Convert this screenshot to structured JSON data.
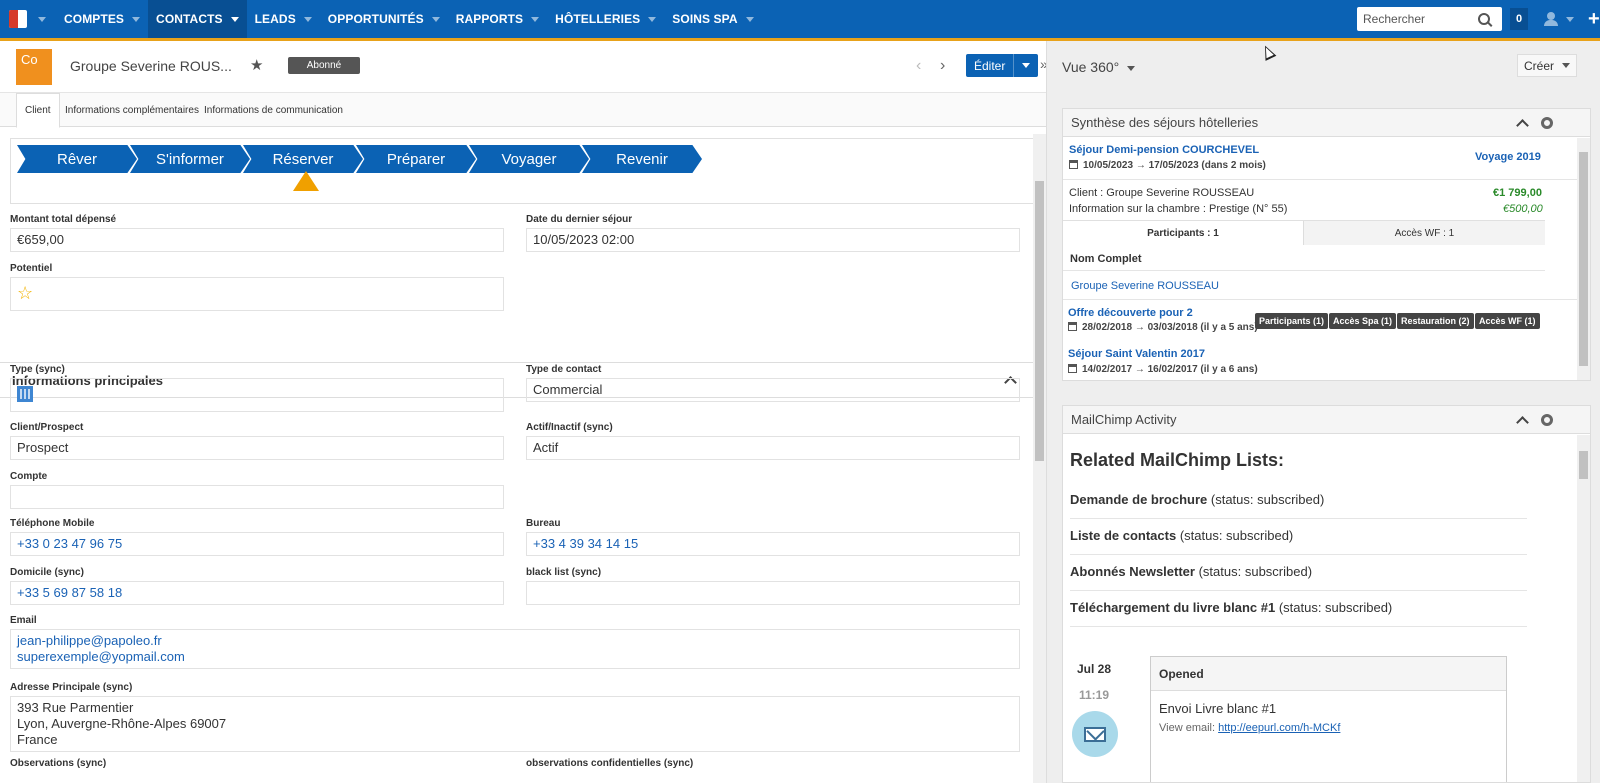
{
  "nav": {
    "items": [
      {
        "label": "COMPTES"
      },
      {
        "label": "CONTACTS"
      },
      {
        "label": "LEADS"
      },
      {
        "label": "OPPORTUNITÉS"
      },
      {
        "label": "RAPPORTS"
      },
      {
        "label": "HÔTELLERIES"
      },
      {
        "label": "SOINS SPA"
      }
    ],
    "active": "CONTACTS",
    "search_placeholder": "Rechercher",
    "notifications": "0",
    "plus": "+"
  },
  "record": {
    "avatar": "Co",
    "title": "Groupe Severine ROUS...",
    "status": "Abonné",
    "edit_label": "Éditer",
    "prev": "‹",
    "next": "›",
    "more": "»",
    "favorite": "★"
  },
  "tabs": [
    "Client",
    "Informations complémentaires",
    "Informations de communication"
  ],
  "stages": [
    "Rêver",
    "S'informer",
    "Réserver",
    "Préparer",
    "Voyager",
    "Revenir"
  ],
  "current_stage": "Réserver",
  "fields": {
    "montant": {
      "label": "Montant total dépensé",
      "value": "€659,00"
    },
    "dernier_sejour": {
      "label": "Date du dernier séjour",
      "value": "10/05/2023 02:00"
    },
    "potentiel": {
      "label": "Potentiel",
      "value": "☆"
    },
    "type": {
      "label": "Type (sync)",
      "icon": "building-icon"
    },
    "type_contact": {
      "label": "Type de contact",
      "value": "Commercial"
    },
    "client_prospect": {
      "label": "Client/Prospect",
      "value": "Prospect"
    },
    "actif": {
      "label": "Actif/Inactif (sync)",
      "value": "Actif"
    },
    "compte": {
      "label": "Compte",
      "value": ""
    },
    "tel_mobile": {
      "label": "Téléphone Mobile",
      "value": "+33 0 23 47 96 75"
    },
    "bureau": {
      "label": "Bureau",
      "value": "+33 4 39 34 14 15"
    },
    "domicile": {
      "label": "Domicile (sync)",
      "value": "+33 5 69 87 58 18"
    },
    "blacklist": {
      "label": "black list (sync)",
      "value": ""
    },
    "email": {
      "label": "Email",
      "values": [
        "jean-philippe@papoleo.fr",
        "superexemple@yopmail.com"
      ]
    },
    "adresse": {
      "label": "Adresse Principale (sync)",
      "lines": [
        "393 Rue Parmentier",
        "Lyon, Auvergne-Rhône-Alpes 69007",
        "France"
      ]
    },
    "observations": {
      "label": "Observations (sync)"
    },
    "observations_conf": {
      "label": "observations confidentielles (sync)"
    }
  },
  "section": {
    "title": "Informations principales"
  },
  "right": {
    "vue_title": "Vue 360°",
    "creer_label": "Créer",
    "sejours": {
      "title": "Synthèse des séjours hôtelleries",
      "s1": {
        "name": "Séjour Demi-pension COURCHEVEL",
        "dates": "10/05/2023 → 17/05/2023 (dans 2 mois)",
        "tag": "Voyage 2019",
        "client": "Client : Groupe Severine ROUSSEAU",
        "price": "€1 799,00",
        "chambre": "Information sur la chambre : Prestige (N° 55)",
        "price2": "€500,00",
        "tab_participants": "Participants : 1",
        "tab_acces": "Accès WF : 1",
        "col_nom": "Nom Complet",
        "participant": "Groupe Severine ROUSSEAU"
      },
      "s2": {
        "name": "Offre découverte pour 2",
        "dates": "28/02/2018 → 03/03/2018 (il y a 5 ans)",
        "chips": [
          "Participants (1)",
          "Accès Spa (1)",
          "Restauration (2)",
          "Accès WF (1)"
        ]
      },
      "s3": {
        "name": "Séjour Saint Valentin 2017",
        "dates": "14/02/2017 → 16/02/2017 (il y a 6 ans)"
      }
    },
    "mailchimp": {
      "title": "MailChimp Activity",
      "heading": "Related MailChimp Lists:",
      "lists": [
        {
          "name": "Demande de brochure",
          "status": " (status: subscribed)"
        },
        {
          "name": "Liste de contacts",
          "status": " (status: subscribed)"
        },
        {
          "name": "Abonnés Newsletter",
          "status": " (status: subscribed)"
        },
        {
          "name": "Téléchargement du livre blanc #1",
          "status": " (status: subscribed)"
        }
      ],
      "timeline": {
        "date": "Jul 28",
        "time": "11:19",
        "card_title": "Opened",
        "card_body": "Envoi Livre blanc #1",
        "view_label": "View email: ",
        "view_link": "http://eepurl.com/h-MCKf"
      }
    }
  }
}
